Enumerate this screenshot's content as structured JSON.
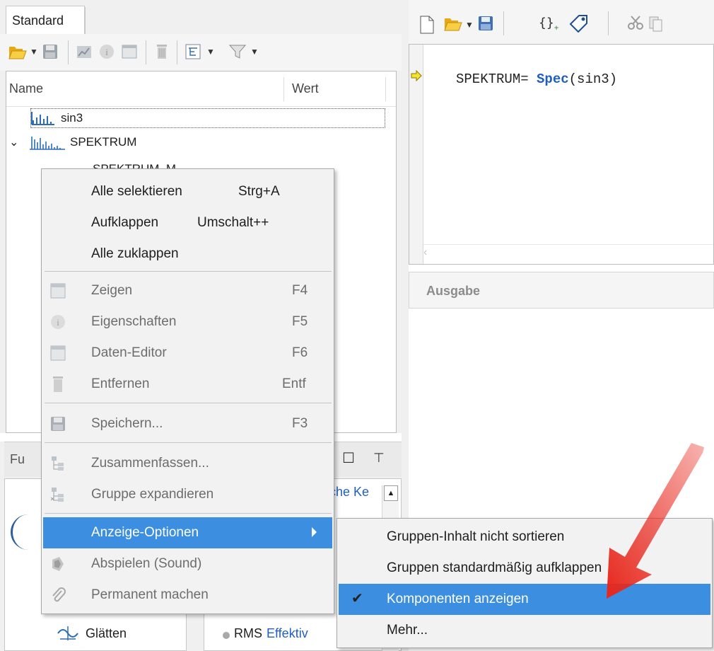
{
  "left": {
    "tab_label": "Standard",
    "columns": {
      "name": "Name",
      "value": "Wert"
    },
    "tree": [
      {
        "label": "sin3"
      },
      {
        "label": "SPEKTRUM"
      },
      {
        "label": "SPEKTRUM_M"
      }
    ]
  },
  "editor": {
    "code_lhs": "SPEKTRUM= ",
    "code_func": "Spec",
    "code_arg": "(sin3)"
  },
  "output": {
    "title": "Ausgabe"
  },
  "bottom": {
    "tab_label": "Fu",
    "link_text": "sche Ke",
    "items": [
      "Glätten"
    ],
    "rms_label": "RMS",
    "rms_desc": "Effektiv"
  },
  "context_menu": {
    "items": [
      {
        "label": "Alle selektieren",
        "shortcut": "Strg+A"
      },
      {
        "label": "Aufklappen",
        "shortcut": "Umschalt++"
      },
      {
        "label": "Alle zuklappen",
        "shortcut": ""
      },
      {
        "label": "Zeigen",
        "shortcut": "F4"
      },
      {
        "label": "Eigenschaften",
        "shortcut": "F5"
      },
      {
        "label": "Daten-Editor",
        "shortcut": "F6"
      },
      {
        "label": "Entfernen",
        "shortcut": "Entf"
      },
      {
        "label": "Speichern...",
        "shortcut": "F3"
      },
      {
        "label": "Zusammenfassen...",
        "shortcut": ""
      },
      {
        "label": "Gruppe expandieren",
        "shortcut": ""
      },
      {
        "label": "Anzeige-Optionen",
        "shortcut": ""
      },
      {
        "label": "Abspielen (Sound)",
        "shortcut": ""
      },
      {
        "label": "Permanent machen",
        "shortcut": ""
      }
    ]
  },
  "submenu": {
    "items": [
      {
        "label": "Gruppen-Inhalt nicht sortieren",
        "checked": false
      },
      {
        "label": "Gruppen standardmäßig aufklappen",
        "checked": false
      },
      {
        "label": "Komponenten anzeigen",
        "checked": true
      },
      {
        "label": "Mehr...",
        "checked": false
      }
    ],
    "check_glyph": "✔"
  },
  "colors": {
    "highlight": "#3c8fe0",
    "arrow": "#e8271c",
    "link": "#1f5fbf"
  }
}
